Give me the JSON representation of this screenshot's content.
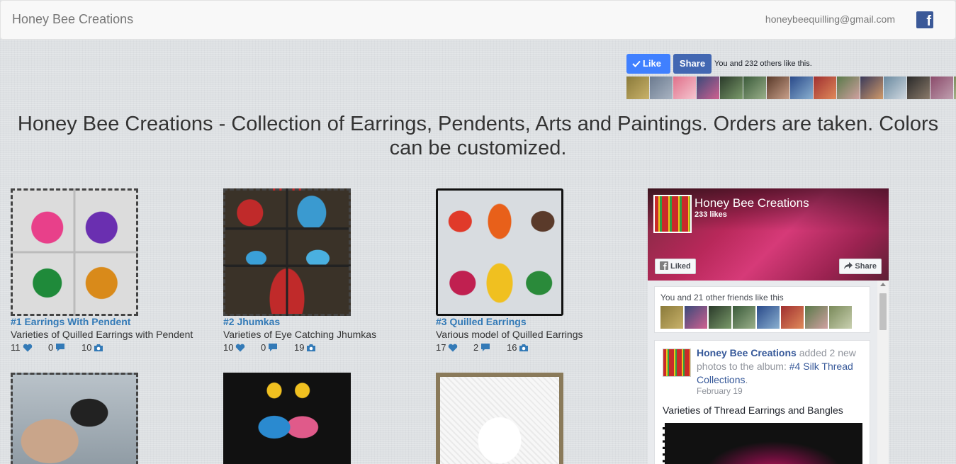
{
  "navbar": {
    "brand": "Honey Bee Creations",
    "email": "honeybeequilling@gmail.com",
    "facebook_icon": "facebook-icon",
    "facebook_color": "#3b5998"
  },
  "like_widget": {
    "like_label": "Like",
    "share_label": "Share",
    "social_text": "You and 232 others like this.",
    "like_color": "#4080ff",
    "share_color": "#4267b2"
  },
  "headline": "Honey Bee Creations - Collection of Earrings, Pendents, Arts and Paintings. Orders are taken. Colors can be customized.",
  "albums": [
    {
      "title": "#1 Earrings With Pendent",
      "description": "Varieties of Quilled Earrings with Pendent",
      "likes": "11",
      "comments": "0",
      "photos": "10"
    },
    {
      "title": "#2 Jhumkas",
      "description": "Varieties of Eye Catching Jhumkas",
      "likes": "10",
      "comments": "0",
      "photos": "19"
    },
    {
      "title": "#3 Quilled Earrings",
      "description": "Various model of Quilled Earrings",
      "likes": "17",
      "comments": "2",
      "photos": "16"
    }
  ],
  "page_plugin": {
    "page_name": "Honey Bee Creations",
    "likes_text": "233 likes",
    "liked_label": "Liked",
    "share_label": "Share",
    "friends_text": "You and 21 other friends like this",
    "post": {
      "author": "Honey Bee Creations",
      "action_text": "added 2 new photos to the album:",
      "album_link": "#4 Silk Thread Collections",
      "date": "February 19",
      "text": "Varieties of Thread Earrings and Bangles"
    }
  }
}
